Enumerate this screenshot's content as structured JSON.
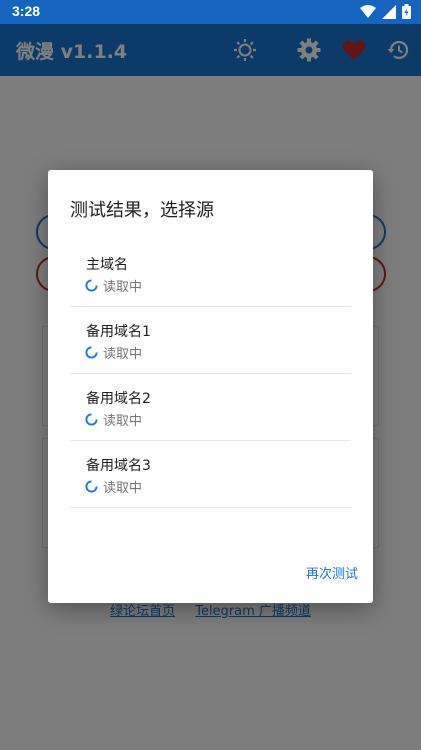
{
  "status_bar": {
    "time": "3:28",
    "icons": [
      "wifi-icon",
      "signal-icon",
      "battery-icon"
    ]
  },
  "app_bar": {
    "title": "微漫 v1.1.4",
    "actions": [
      "brightness-icon",
      "settings-icon",
      "favorite-icon",
      "history-icon"
    ],
    "colors": {
      "bar": "#1976d2",
      "status": "#1565c0",
      "heart": "#c62828"
    }
  },
  "background": {
    "links": [
      "绿论坛首页",
      "Telegram 广播频道"
    ]
  },
  "dialog": {
    "title": "测试结果，选择源",
    "items": [
      {
        "name": "主域名",
        "status": "读取中"
      },
      {
        "name": "备用域名1",
        "status": "读取中"
      },
      {
        "name": "备用域名2",
        "status": "读取中"
      },
      {
        "name": "备用域名3",
        "status": "读取中"
      }
    ],
    "retest_label": "再次测试"
  }
}
